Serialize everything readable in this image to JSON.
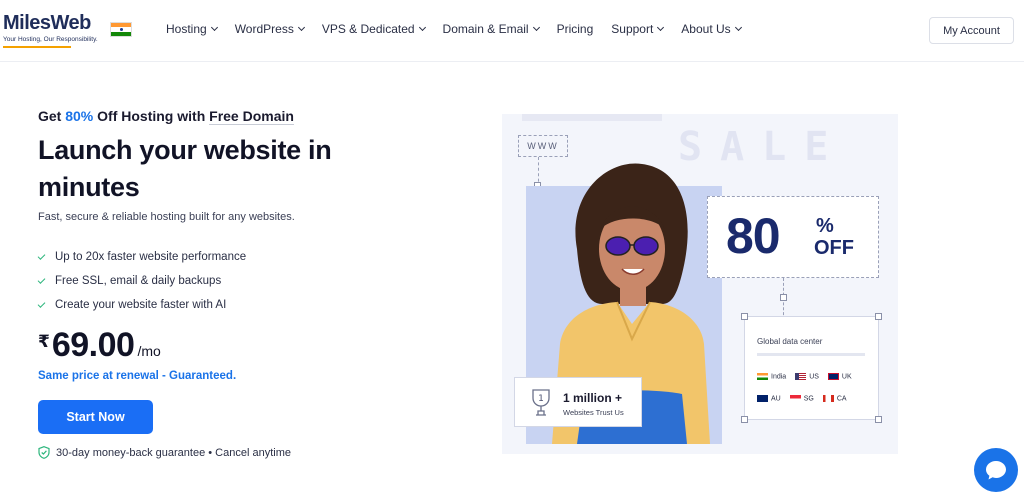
{
  "header": {
    "logo": {
      "word": "MilesWeb",
      "tagline": "Your Hosting, Our Responsibility."
    },
    "nav": [
      {
        "label": "Hosting",
        "dropdown": true
      },
      {
        "label": "WordPress",
        "dropdown": true
      },
      {
        "label": "VPS & Dedicated",
        "dropdown": true
      },
      {
        "label": "Domain & Email",
        "dropdown": true
      },
      {
        "label": "Pricing",
        "dropdown": false
      },
      {
        "label": "Support",
        "dropdown": true
      },
      {
        "label": "About Us",
        "dropdown": true
      }
    ],
    "account_label": "My Account"
  },
  "hero": {
    "promo_prefix": "Get ",
    "promo_highlight": "80%",
    "promo_mid": " Off Hosting with ",
    "promo_underlined": "Free Domain",
    "title": "Launch your website in minutes",
    "subtitle": "Fast, secure & reliable hosting built for any websites.",
    "features": [
      "Up to 20x faster website performance",
      "Free SSL, email & daily backups",
      "Create your website faster with AI"
    ],
    "price": {
      "currency": "₹",
      "amount": "69.00",
      "period": "/mo"
    },
    "renewal_note": "Same price at renewal - Guaranteed.",
    "cta_label": "Start Now",
    "guarantee": "30-day money-back guarantee • Cancel anytime"
  },
  "artwork": {
    "www": "WWW",
    "sale": "SALE",
    "discount_number": "80",
    "discount_percent": "%",
    "discount_word": "OFF",
    "datacenter": {
      "title": "Global data center",
      "row1": [
        "India",
        "US",
        "UK"
      ],
      "row2": [
        "AU",
        "SG",
        "CA"
      ]
    },
    "trust": {
      "count": "1 million +",
      "caption": "Websites Trust Us",
      "badge": "1"
    }
  },
  "colors": {
    "accent": "#1a73e8",
    "cta": "#1a6ef5",
    "check": "#2eb67d",
    "brand_navy": "#1f2d5a"
  }
}
